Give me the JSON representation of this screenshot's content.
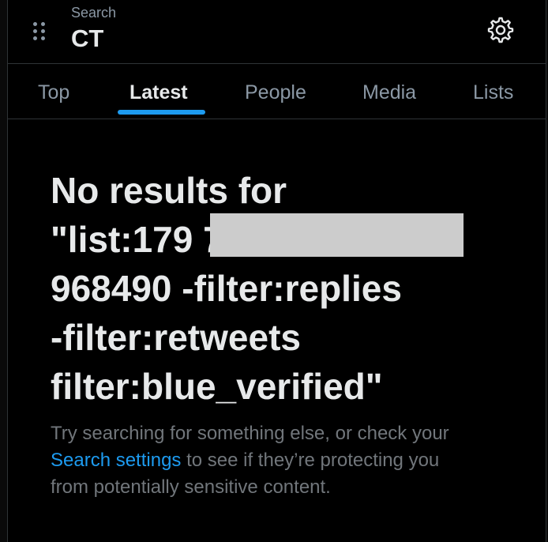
{
  "header": {
    "subtitle": "Search",
    "title": "CT",
    "settings_icon": "gear-icon",
    "drag_icon": "drag-handle-icon"
  },
  "tabs": [
    {
      "label": "Top",
      "active": false
    },
    {
      "label": "Latest",
      "active": true
    },
    {
      "label": "People",
      "active": false
    },
    {
      "label": "Media",
      "active": false
    },
    {
      "label": "Lists",
      "active": false
    }
  ],
  "empty_state": {
    "title": "No results for\n\"list:179 7\n968490 -filter:replies\n-filter:retweets\nfilter:blue_verified\"",
    "body_prefix": "Try searching for something else, or check your ",
    "body_link": "Search settings",
    "body_suffix": " to see if they’re protecting you from potentially sensitive content."
  },
  "colors": {
    "background": "#000000",
    "primary_text": "#e7e9ea",
    "secondary_text": "#71767b",
    "accent": "#1d9bf0",
    "divider": "#2f3336",
    "redaction": "#cccccc"
  }
}
